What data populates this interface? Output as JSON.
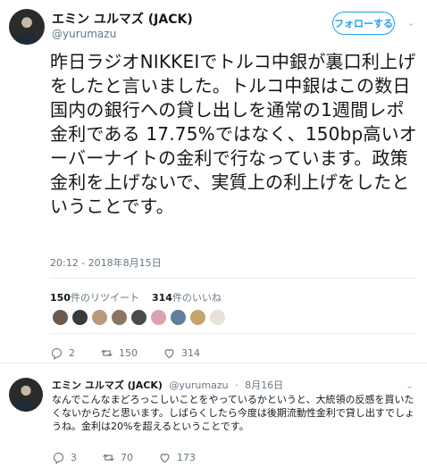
{
  "tweet": {
    "author_name": "エミン ユルマズ (JACK)",
    "author_handle": "@yurumazu",
    "follow_label": "フォローする",
    "text": "昨日ラジオNIKKEIでトルコ中銀が裏口利上げをしたと言いました。トルコ中銀はこの数日国内の銀行への貸し出しを通常の1週間レポ金利である 17.75%ではなく、150bp高いオーバーナイトの金利で行なっています。政策金利を上げないで、実質上の利上げをしたということです。",
    "timestamp": "20:12 - 2018年8月15日",
    "retweet_count": "150",
    "retweet_label": "件のリツイート",
    "like_count": "314",
    "like_label": "件のいいね",
    "action_counts": {
      "reply": "2",
      "retweet": "150",
      "like": "314"
    },
    "liker_colors": [
      "#6b5b4e",
      "#3a3a3a",
      "#b89a7c",
      "#8a7560",
      "#4a4a4a",
      "#d9a3b0",
      "#5f7f9a",
      "#c7a46e",
      "#e8e2d6"
    ]
  },
  "reply": {
    "author_name": "エミン ユルマズ (JACK)",
    "author_handle": "@yurumazu",
    "date": "8月16日",
    "separator": "·",
    "text": "なんでこんなまどろっこしいことをやっているかというと、大統領の反感を買いたくないからだと思います。しばらくしたら今度は後期流動性金利で貸し出すでしょうね。金利は20%を超えるということです。",
    "action_counts": {
      "reply": "3",
      "retweet": "70",
      "like": "173"
    }
  },
  "colors": {
    "accent": "#1da1f2",
    "muted": "#657786",
    "text": "#14171a",
    "border": "#e6ecf0"
  }
}
